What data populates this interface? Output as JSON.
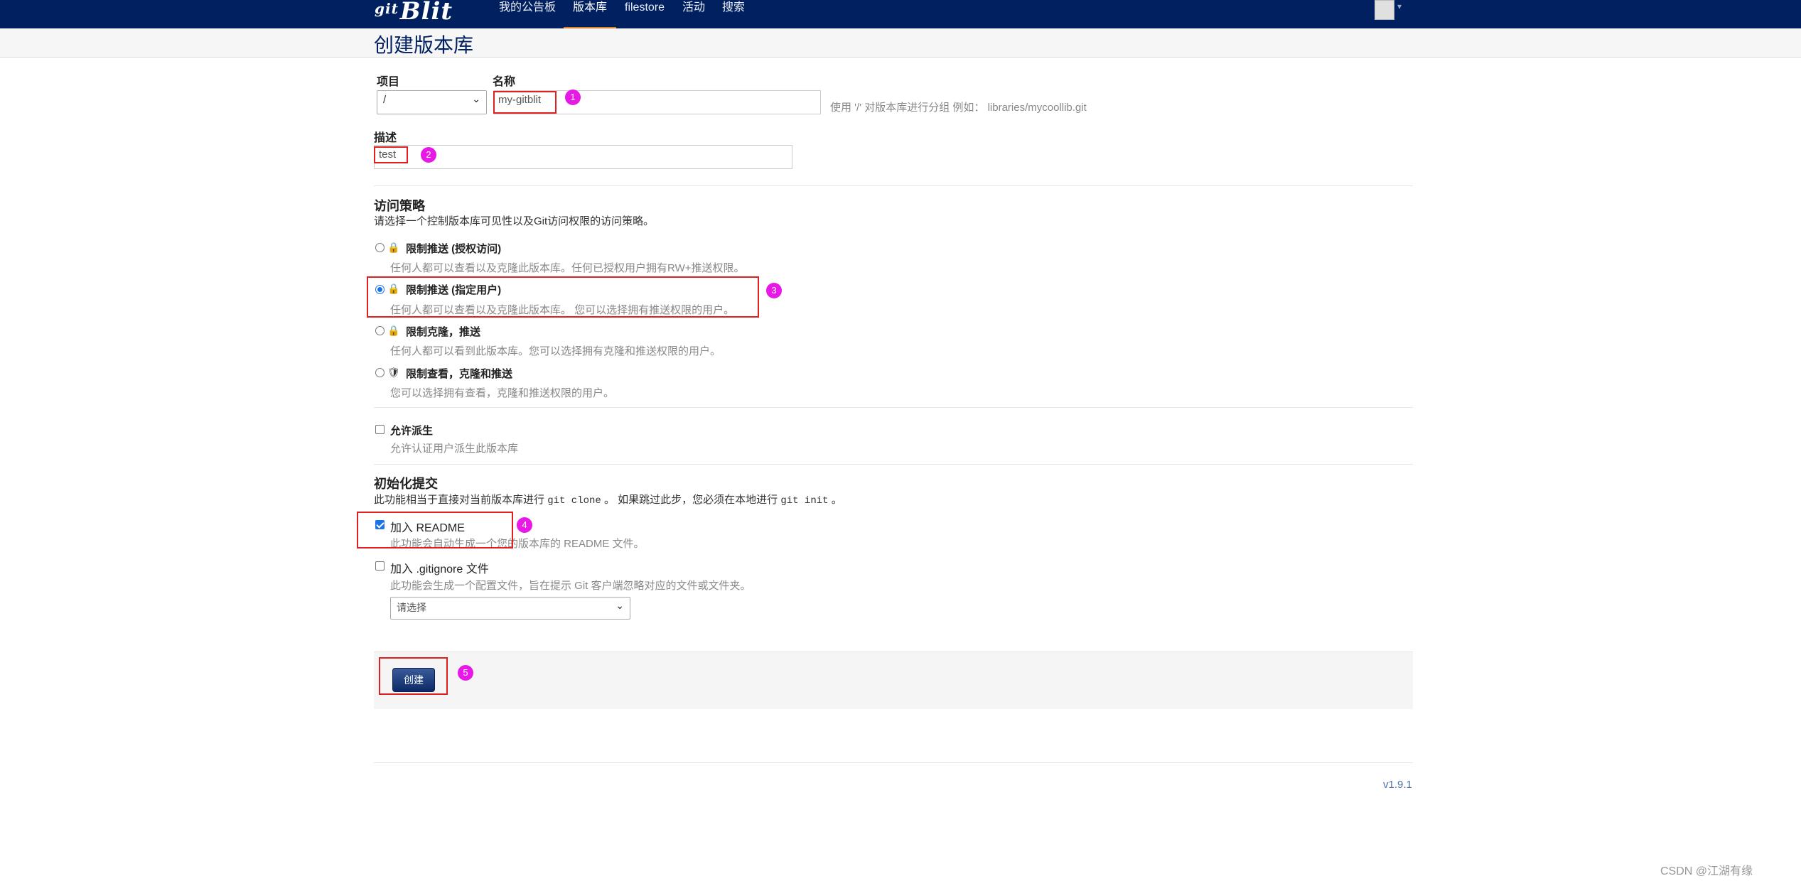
{
  "nav": {
    "logo_prefix": "git",
    "logo": "Blit",
    "items": [
      "我的公告板",
      "版本库",
      "filestore",
      "活动",
      "搜索"
    ]
  },
  "page": {
    "title": "创建版本库"
  },
  "form": {
    "project_label": "项目",
    "project_value": "/",
    "name_label": "名称",
    "name_value": "my-gitblit",
    "name_hint": "使用 '/' 对版本库进行分组 例如： libraries/mycoollib.git",
    "desc_label": "描述",
    "desc_value": "test"
  },
  "access": {
    "title": "访问策略",
    "subtitle": "请选择一个控制版本库可见性以及Git访问权限的访问策略。",
    "options": [
      {
        "label": "限制推送 (授权访问)",
        "desc": "任何人都可以查看以及克隆此版本库。任何已授权用户拥有RW+推送权限。",
        "icon": "lock-icon"
      },
      {
        "label": "限制推送 (指定用户)",
        "desc": "任何人都可以查看以及克隆此版本库。 您可以选择拥有推送权限的用户。",
        "icon": "lock-icon"
      },
      {
        "label": "限制克隆，推送",
        "desc": "任何人都可以看到此版本库。您可以选择拥有克隆和推送权限的用户。",
        "icon": "lock-icon"
      },
      {
        "label": "限制查看，克隆和推送",
        "desc": "您可以选择拥有查看，克隆和推送权限的用户。",
        "icon": "shield-icon"
      }
    ],
    "selected_index": 1
  },
  "fork": {
    "label": "允许派生",
    "desc": "允许认证用户派生此版本库"
  },
  "init": {
    "title": "初始化提交",
    "desc_prefix": "此功能相当于直接对当前版本库进行",
    "desc_code1": "git clone",
    "desc_middle": "。 如果跳过此步，您必须在本地进行",
    "desc_code2": "git init",
    "desc_suffix": "。",
    "readme_label": "加入 README",
    "readme_desc": "此功能会自动生成一个您的版本库的 README 文件。",
    "gitignore_label": "加入 .gitignore 文件",
    "gitignore_desc": "此功能会生成一个配置文件，旨在提示 Git 客户端忽略对应的文件或文件夹。",
    "gitignore_select": "请选择"
  },
  "actions": {
    "create_label": "创建"
  },
  "markers": [
    "1",
    "2",
    "3",
    "4",
    "5"
  ],
  "footer": {
    "version": "v1.9.1",
    "watermark": "CSDN @江湖有缘"
  },
  "colors": {
    "navbar": "#002060",
    "marker": "#e619e6",
    "highlight": "#e02020",
    "accent": "#e27d27"
  }
}
